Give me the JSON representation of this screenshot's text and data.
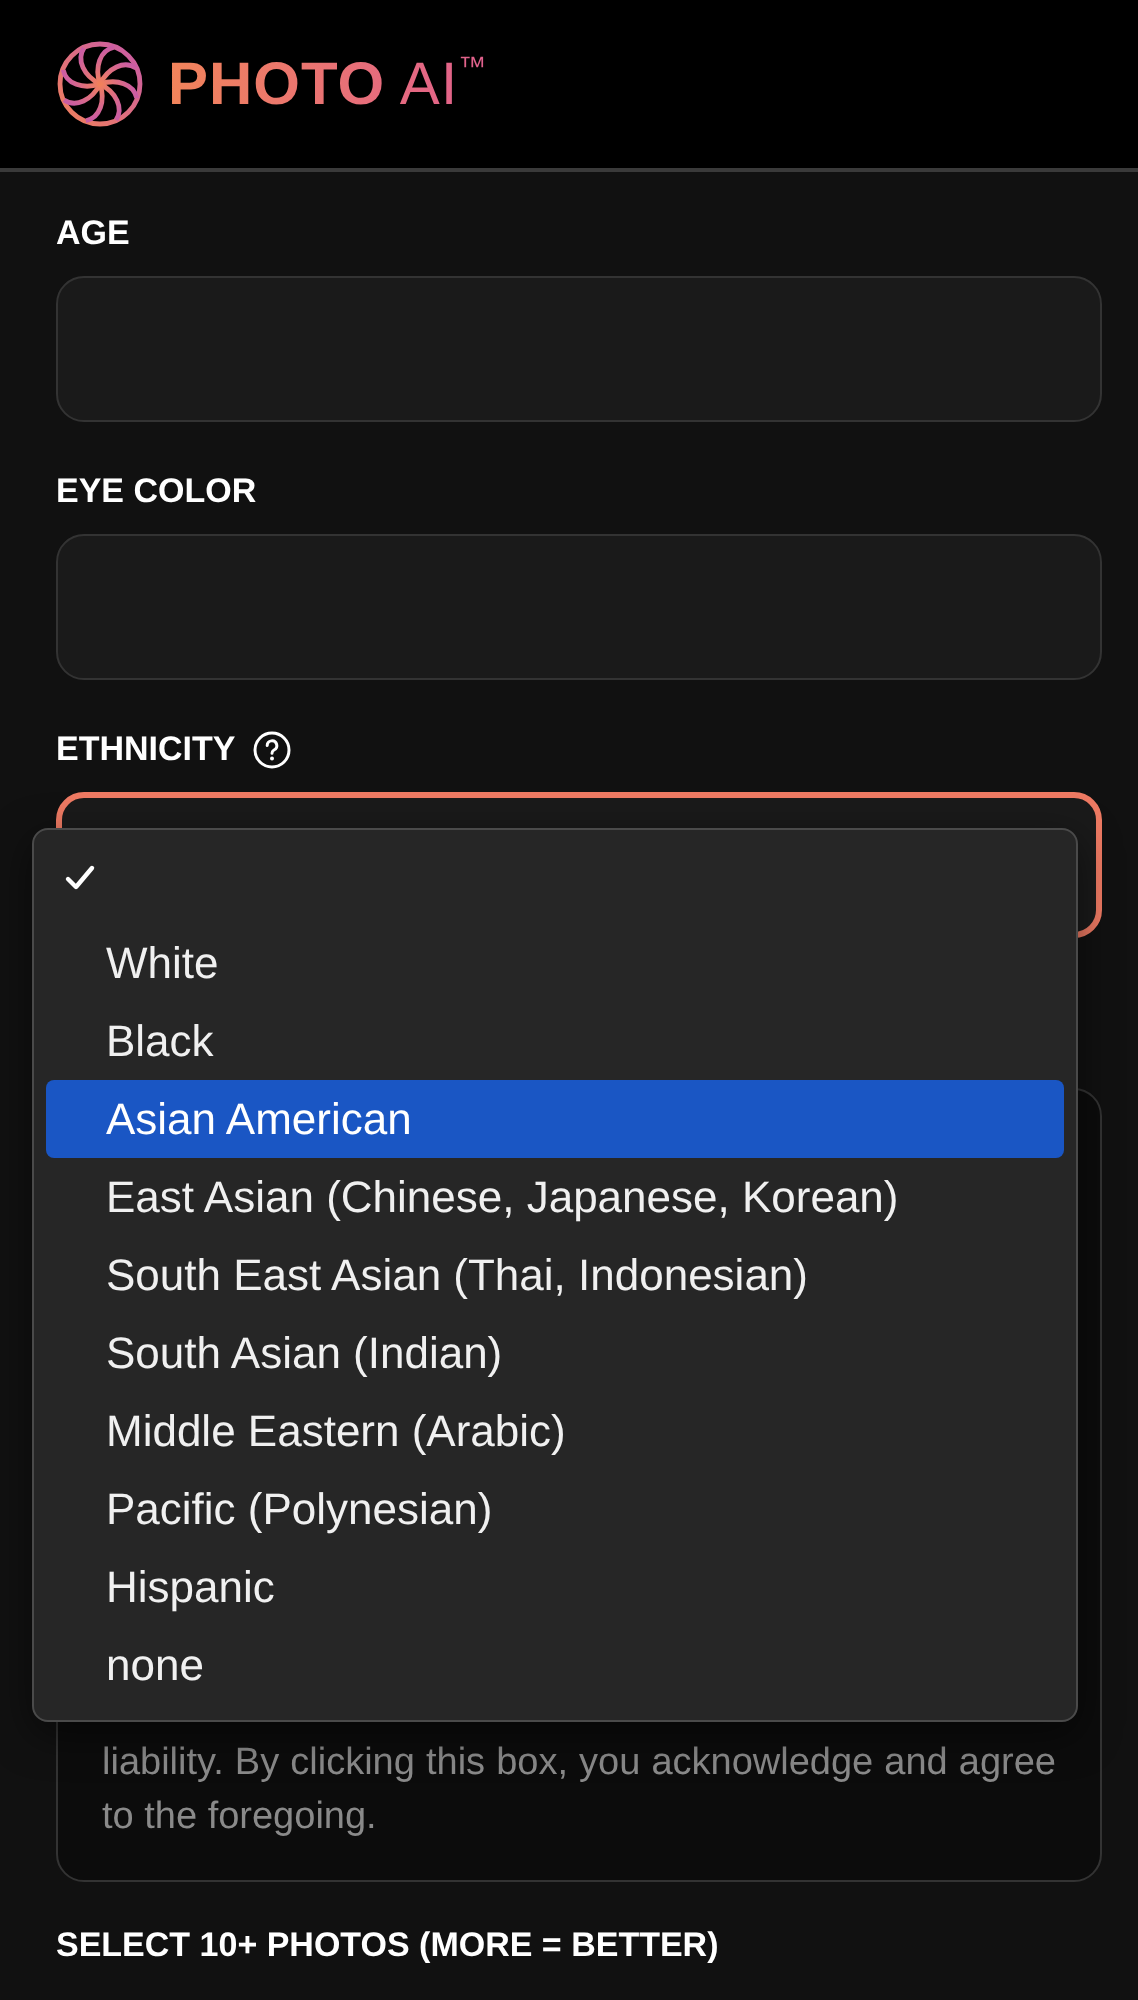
{
  "header": {
    "brand": "PHOTO AI",
    "trademark": "™"
  },
  "fields": [
    {
      "label": "AGE",
      "kind": "input",
      "focused": false,
      "help": false
    },
    {
      "label": "EYE COLOR",
      "kind": "input",
      "focused": false,
      "help": false
    },
    {
      "label": "ETHNICITY",
      "kind": "select",
      "focused": true,
      "help": true
    }
  ],
  "dropdown": {
    "options": [
      {
        "checked": true,
        "highlighted": false
      },
      {
        "label": "White",
        "checked": false,
        "highlighted": false
      },
      {
        "label": "Black",
        "checked": false,
        "highlighted": false
      },
      {
        "label": "Asian American",
        "checked": false,
        "highlighted": true
      },
      {
        "label": "East Asian (Chinese, Japanese, Korean)",
        "checked": false,
        "highlighted": false
      },
      {
        "label": "South East Asian (Thai, Indonesian)",
        "checked": false,
        "highlighted": false
      },
      {
        "label": "South Asian (Indian)",
        "checked": false,
        "highlighted": false
      },
      {
        "label": "Middle Eastern (Arabic)",
        "checked": false,
        "highlighted": false
      },
      {
        "label": "Pacific (Polynesian)",
        "checked": false,
        "highlighted": false
      },
      {
        "label": "Hispanic",
        "checked": false,
        "highlighted": false
      },
      {
        "label": "none",
        "checked": false,
        "highlighted": false
      }
    ]
  },
  "disclaimer": {
    "text": "liability. By clicking this box, you acknowledge and agree to the foregoing."
  },
  "photos_label": "SELECT 10+ PHOTOS (MORE = BETTER)"
}
